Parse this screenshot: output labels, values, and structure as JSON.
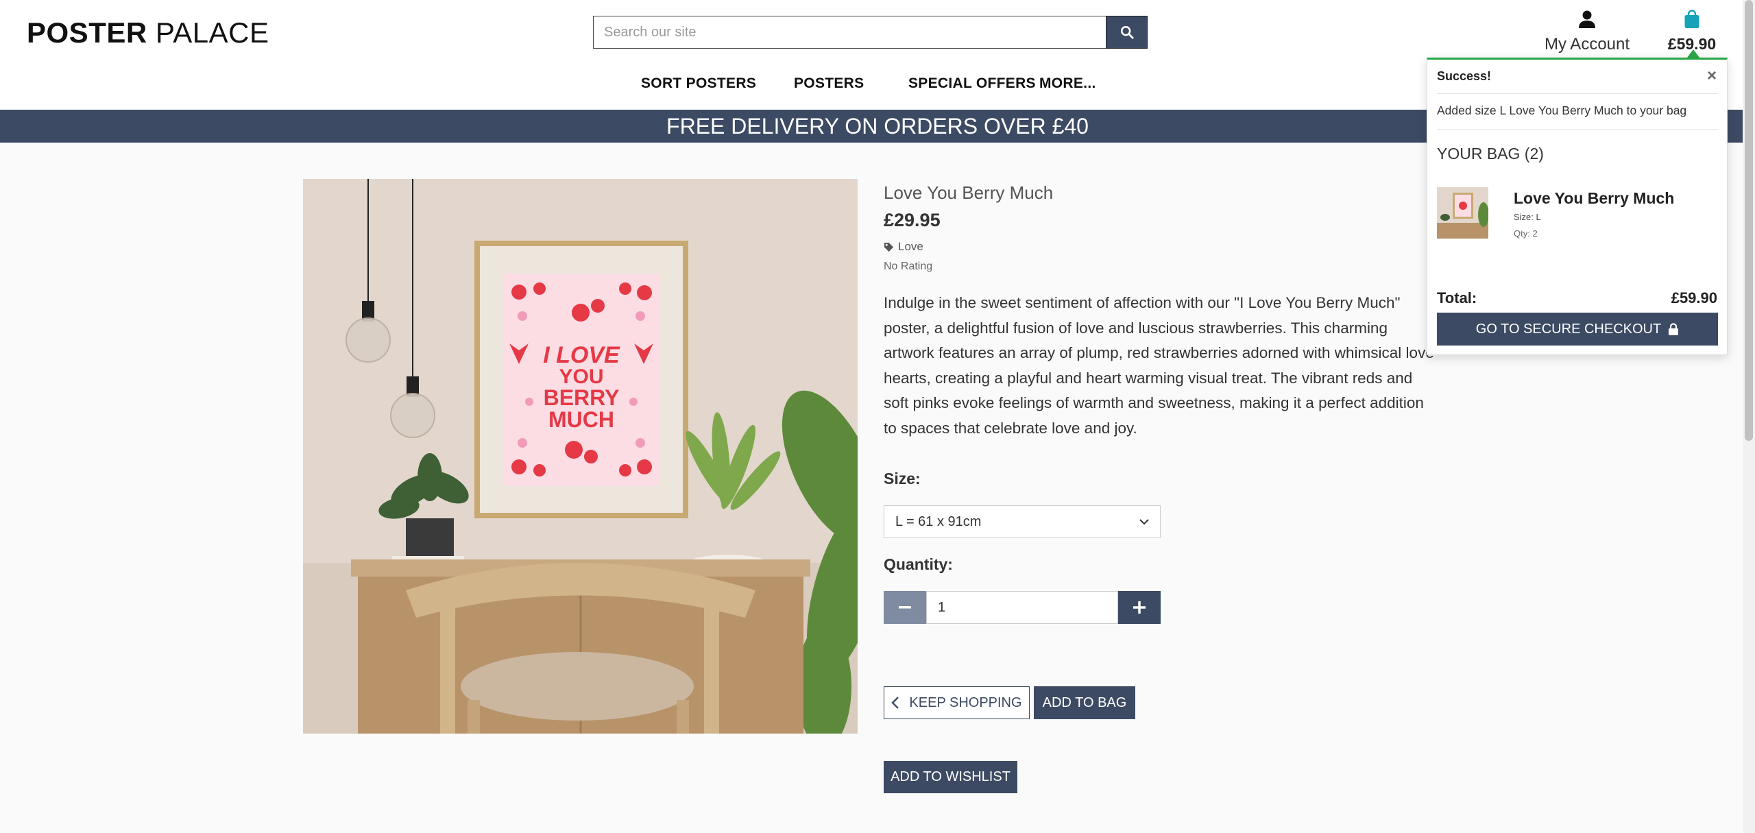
{
  "header": {
    "logo_bold": "POSTER",
    "logo_rest": "PALACE",
    "search_placeholder": "Search our site",
    "account_label": "My Account",
    "bag_total": "£59.90"
  },
  "nav": {
    "items": [
      "SORT POSTERS",
      "POSTERS",
      "SPECIAL OFFERS",
      "MORE..."
    ]
  },
  "banner": "FREE DELIVERY ON ORDERS OVER £40",
  "product": {
    "title": "Love You Berry Much",
    "price": "£29.95",
    "tag": "Love",
    "rating": "No Rating",
    "description": "Indulge in the sweet sentiment of affection with our \"I Love You Berry Much\" poster, a delightful fusion of love and luscious strawberries. This charming artwork features an array of plump, red strawberries adorned with whimsical love hearts, creating a playful and heart warming visual treat. The vibrant reds and soft pinks evoke feelings of warmth and sweetness, making it a perfect addition to spaces that celebrate love and joy.",
    "size_label": "Size:",
    "size_value": "L = 61 x 91cm",
    "quantity_label": "Quantity:",
    "quantity_value": "1",
    "keep_shopping": "KEEP SHOPPING",
    "add_to_bag": "ADD TO BAG",
    "add_to_wishlist": "ADD TO WISHLIST",
    "poster_text": [
      "I LOVE",
      "YOU",
      "BERRY",
      "MUCH"
    ]
  },
  "toast": {
    "heading": "Success!",
    "close": "×",
    "message": "Added size L Love You Berry Much to your bag",
    "bag_heading": "YOUR BAG (2)",
    "item_name": "Love You Berry Much",
    "item_size": "Size: L",
    "item_qty": "Qty: 2",
    "total_label": "Total:",
    "total_value": "£59.90",
    "checkout": "GO TO SECURE CHECKOUT"
  },
  "colors": {
    "primary": "#3d4a63",
    "success": "#28a745",
    "bag_icon": "#17a2b8"
  }
}
